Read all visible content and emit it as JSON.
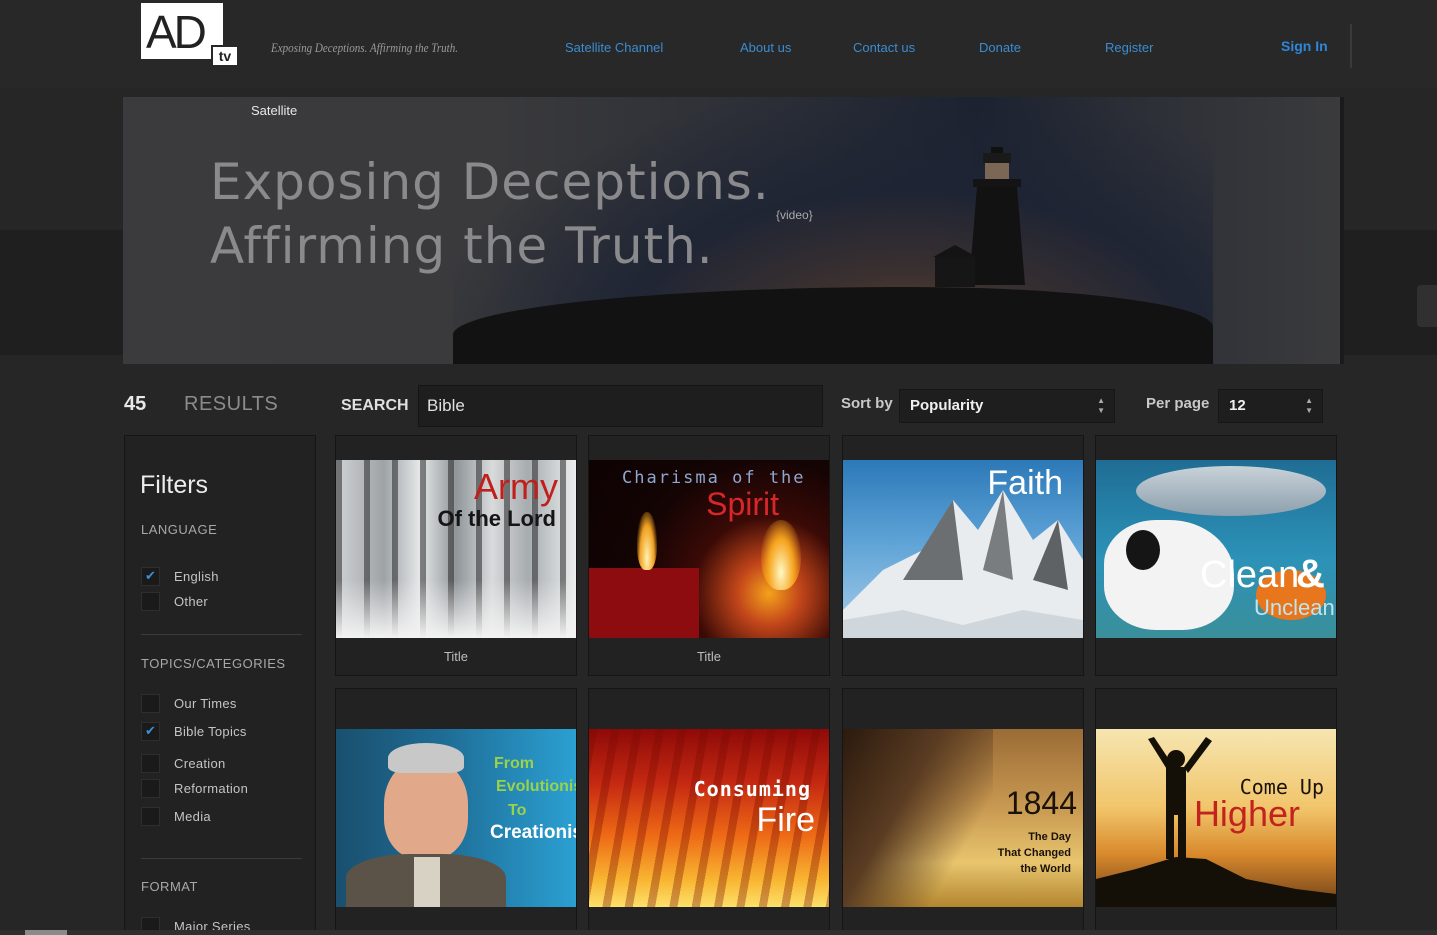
{
  "brand": {
    "logo_text": "AD",
    "logo_sub": "tv",
    "tagline": "Exposing Deceptions. Affirming the Truth."
  },
  "nav": {
    "items": [
      "Satellite Channel",
      "About us",
      "Contact us",
      "Donate",
      "Register"
    ],
    "sign_in": "Sign In"
  },
  "hero": {
    "label": "Satellite",
    "line1": "Exposing Deceptions.",
    "line2": "Affirming the Truth.",
    "video_placeholder": "{video}"
  },
  "results": {
    "count": "45",
    "label": "RESULTS"
  },
  "search": {
    "label": "SEARCH",
    "value": "Bible"
  },
  "sort": {
    "label": "Sort by",
    "value": "Popularity"
  },
  "per_page": {
    "label": "Per page",
    "value": "12"
  },
  "filters": {
    "title": "Filters",
    "language": {
      "heading": "LANGUAGE",
      "options": [
        {
          "label": "English",
          "checked": true
        },
        {
          "label": "Other",
          "checked": false
        }
      ]
    },
    "topics": {
      "heading": "TOPICS/CATEGORIES",
      "options": [
        {
          "label": "Our Times",
          "checked": false
        },
        {
          "label": "Bible Topics",
          "checked": true
        },
        {
          "label": "Creation",
          "checked": false
        },
        {
          "label": "Reformation",
          "checked": false
        },
        {
          "label": "Media",
          "checked": false
        }
      ]
    },
    "format": {
      "heading": "FORMAT",
      "options": [
        {
          "label": "Major Series",
          "checked": false
        }
      ]
    }
  },
  "cards": [
    {
      "thumb_lines": [
        "Army",
        "Of the Lord"
      ],
      "caption": "Title"
    },
    {
      "thumb_lines": [
        "Charisma of the",
        "Spirit"
      ],
      "caption": "Title"
    },
    {
      "thumb_lines": [
        "Faith"
      ],
      "caption": ""
    },
    {
      "thumb_lines": [
        "Clean",
        "&",
        "Unclean"
      ],
      "caption": ""
    },
    {
      "thumb_lines": [
        "From",
        "Evolutionist",
        "To",
        "Creationist"
      ],
      "caption": ""
    },
    {
      "thumb_lines": [
        "Consuming",
        "Fire"
      ],
      "caption": ""
    },
    {
      "thumb_lines": [
        "1844",
        "The Day",
        "That Changed",
        "the World"
      ],
      "caption": ""
    },
    {
      "thumb_lines": [
        "Come Up",
        "Higher"
      ],
      "caption": ""
    }
  ],
  "colors": {
    "link": "#3b8cd0",
    "accent_check": "#3d8fd8",
    "background": "#262626"
  }
}
